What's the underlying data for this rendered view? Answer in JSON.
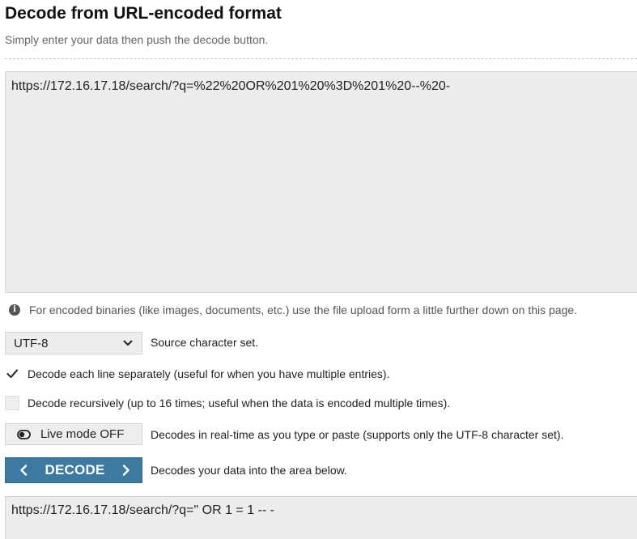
{
  "header": {
    "title": "Decode from URL-encoded format",
    "subtitle": "Simply enter your data then push the decode button."
  },
  "input": {
    "value": "https://172.16.17.18/search/?q=%22%20OR%201%20%3D%201%20--%20-"
  },
  "info": {
    "icon": "info-icon",
    "text": "For encoded binaries (like images, documents, etc.) use the file upload form a little further down on this page."
  },
  "charset": {
    "selected": "UTF-8",
    "label": "Source character set."
  },
  "options": {
    "decode_each_line": {
      "checked": true,
      "label": "Decode each line separately (useful for when you have multiple entries)."
    },
    "decode_recursively": {
      "checked": false,
      "label": "Decode recursively (up to 16 times; useful when the data is encoded multiple times)."
    }
  },
  "live_mode": {
    "button_label": "Live mode OFF",
    "description": "Decodes in real-time as you type or paste (supports only the UTF-8 character set)."
  },
  "decode": {
    "button_label": "DECODE",
    "description": "Decodes your data into the area below."
  },
  "output": {
    "value": "https://172.16.17.18/search/?q=\" OR 1 = 1 -- -"
  },
  "colors": {
    "accent": "#3c7aa1",
    "field_background": "#ededed"
  }
}
